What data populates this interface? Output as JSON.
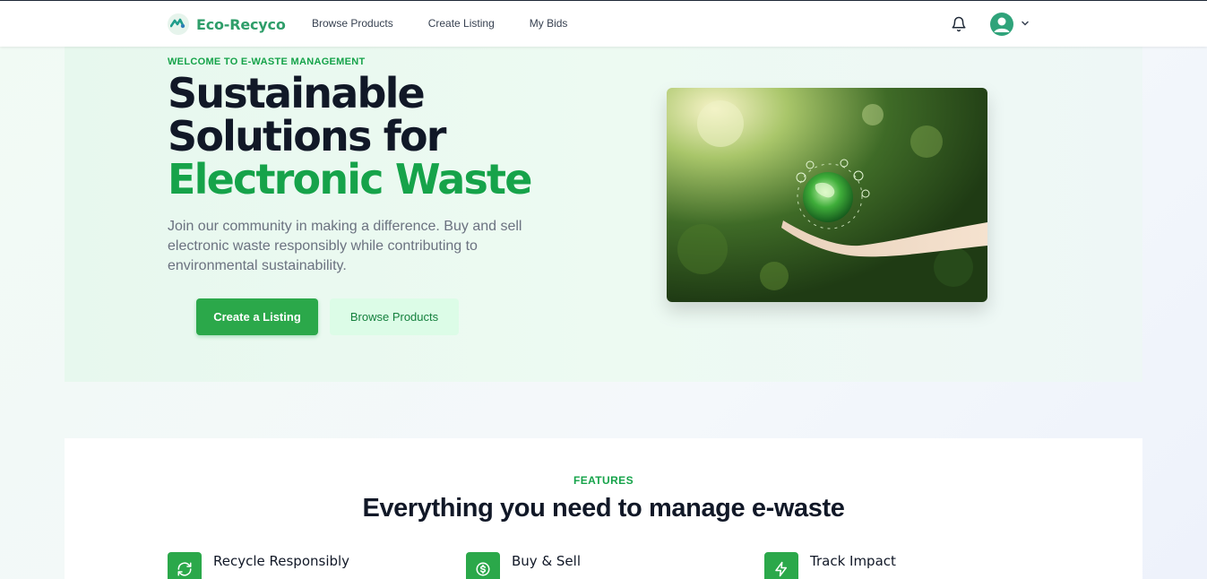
{
  "nav": {
    "brand": "Eco-Recyco",
    "links": [
      "Browse Products",
      "Create Listing",
      "My Bids"
    ]
  },
  "hero": {
    "eyebrow": "WELCOME TO E-WASTE MANAGEMENT",
    "title_line1": "Sustainable",
    "title_line2": "Solutions for",
    "title_accent": "Electronic Waste",
    "description": "Join our community in making a difference. Buy and sell electronic waste responsibly while contributing to environmental sustainability.",
    "primary_button": "Create a Listing",
    "secondary_button": "Browse Products"
  },
  "features": {
    "eyebrow": "FEATURES",
    "title": "Everything you need to manage e-waste",
    "items": [
      {
        "title": "Recycle Responsibly",
        "icon": "recycle-icon"
      },
      {
        "title": "Buy & Sell",
        "icon": "dollar-icon"
      },
      {
        "title": "Track Impact",
        "icon": "lightning-icon"
      }
    ]
  },
  "colors": {
    "accent": "#16a34a",
    "brand": "#2f9e6a",
    "button": "#2ba84a"
  }
}
